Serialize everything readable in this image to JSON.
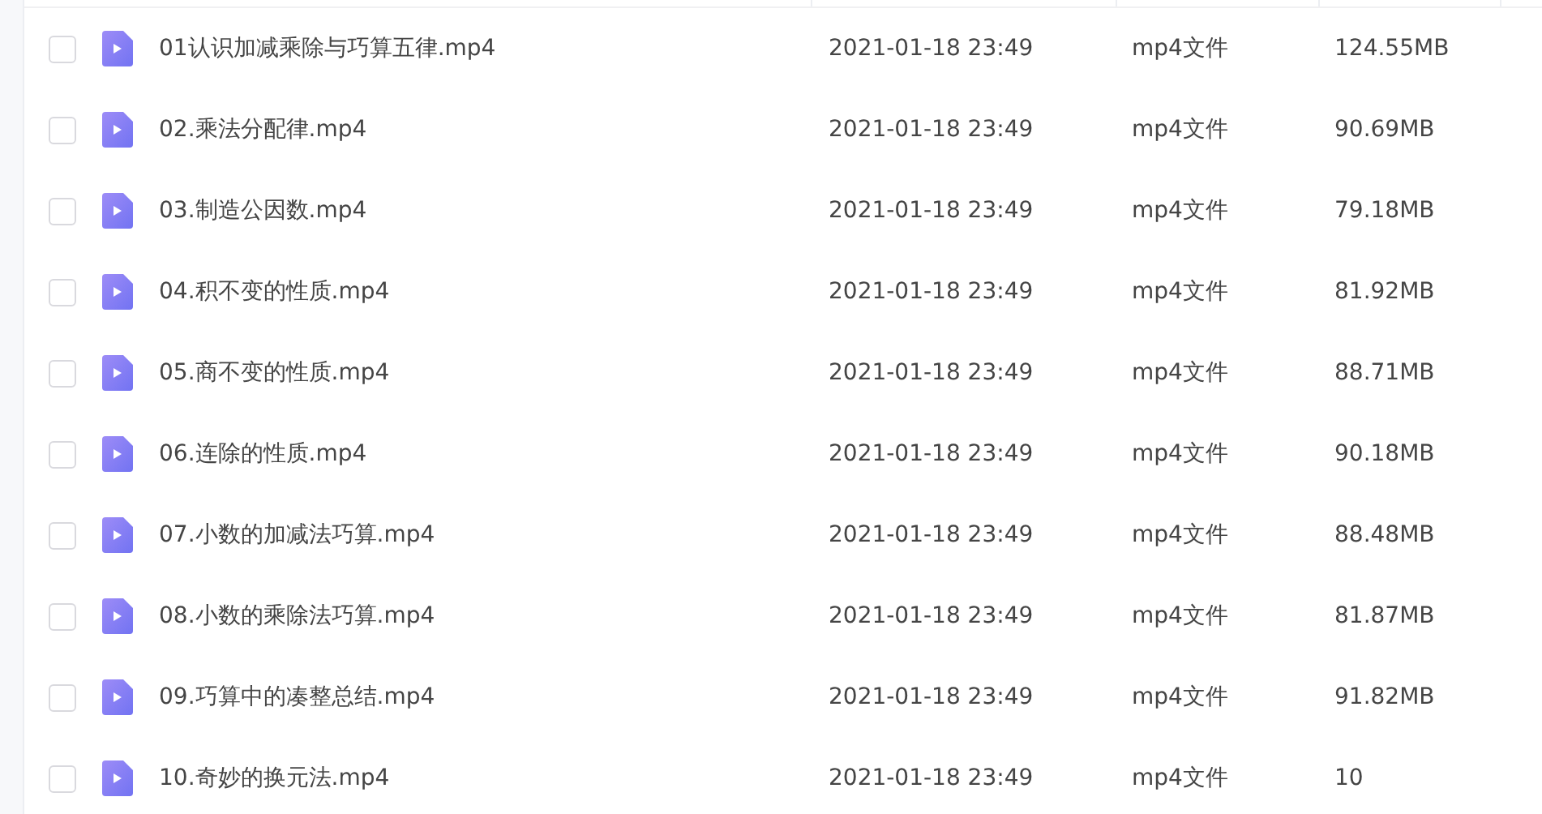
{
  "files": [
    {
      "name": "01认识加减乘除与巧算五律.mp4",
      "modified": "2021-01-18 23:49",
      "type": "mp4文件",
      "size": "124.55MB",
      "checked": false
    },
    {
      "name": "02.乘法分配律.mp4",
      "modified": "2021-01-18 23:49",
      "type": "mp4文件",
      "size": "90.69MB",
      "checked": false
    },
    {
      "name": "03.制造公因数.mp4",
      "modified": "2021-01-18 23:49",
      "type": "mp4文件",
      "size": "79.18MB",
      "checked": false
    },
    {
      "name": "04.积不变的性质.mp4",
      "modified": "2021-01-18 23:49",
      "type": "mp4文件",
      "size": "81.92MB",
      "checked": false
    },
    {
      "name": "05.商不变的性质.mp4",
      "modified": "2021-01-18 23:49",
      "type": "mp4文件",
      "size": "88.71MB",
      "checked": false
    },
    {
      "name": "06.连除的性质.mp4",
      "modified": "2021-01-18 23:49",
      "type": "mp4文件",
      "size": "90.18MB",
      "checked": false
    },
    {
      "name": "07.小数的加减法巧算.mp4",
      "modified": "2021-01-18 23:49",
      "type": "mp4文件",
      "size": "88.48MB",
      "checked": false
    },
    {
      "name": "08.小数的乘除法巧算.mp4",
      "modified": "2021-01-18 23:49",
      "type": "mp4文件",
      "size": "81.87MB",
      "checked": false
    },
    {
      "name": "09.巧算中的凑整总结.mp4",
      "modified": "2021-01-18 23:49",
      "type": "mp4文件",
      "size": "91.82MB",
      "checked": false
    },
    {
      "name": "10.奇妙的换元法.mp4",
      "modified": "2021-01-18 23:49",
      "type": "mp4文件",
      "size": "10",
      "checked": false
    }
  ]
}
